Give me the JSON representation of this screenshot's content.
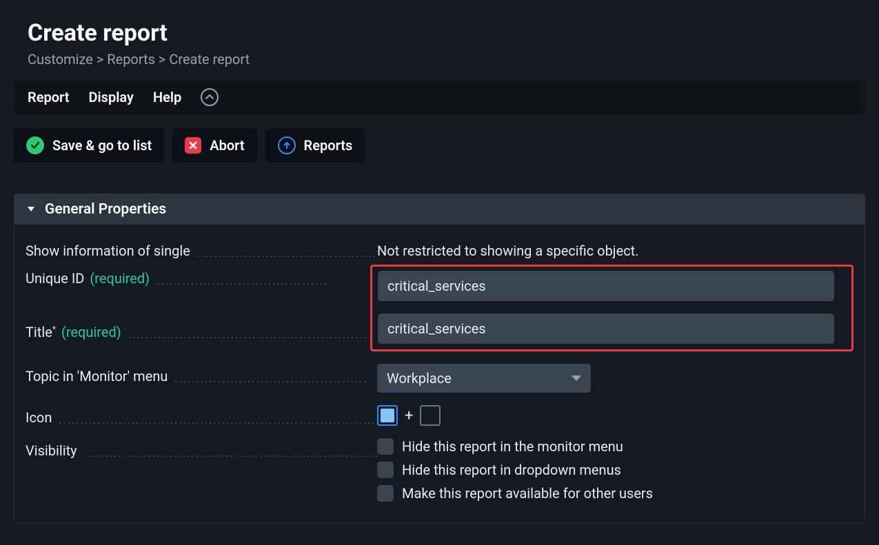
{
  "page": {
    "title": "Create report",
    "breadcrumb": "Customize > Reports > Create report"
  },
  "menubar": {
    "report": "Report",
    "display": "Display",
    "help": "Help"
  },
  "actions": {
    "save": "Save & go to list",
    "abort": "Abort",
    "reports": "Reports"
  },
  "panel": {
    "title": "General Properties",
    "fields": {
      "show_info_label": "Show information of single",
      "show_info_value": "Not restricted to showing a specific object.",
      "unique_id_label": "Unique ID",
      "unique_id_required": "(required)",
      "unique_id_value": "critical_services",
      "title_label": "Title",
      "title_required": "(required)",
      "title_value": "critical_services",
      "topic_label": "Topic in 'Monitor' menu",
      "topic_value": "Workplace",
      "icon_label": "Icon",
      "icon_plus": "+",
      "visibility_label": "Visibility",
      "visibility_opts": [
        "Hide this report in the monitor menu",
        "Hide this report in dropdown menus",
        "Make this report available for other users"
      ]
    }
  }
}
